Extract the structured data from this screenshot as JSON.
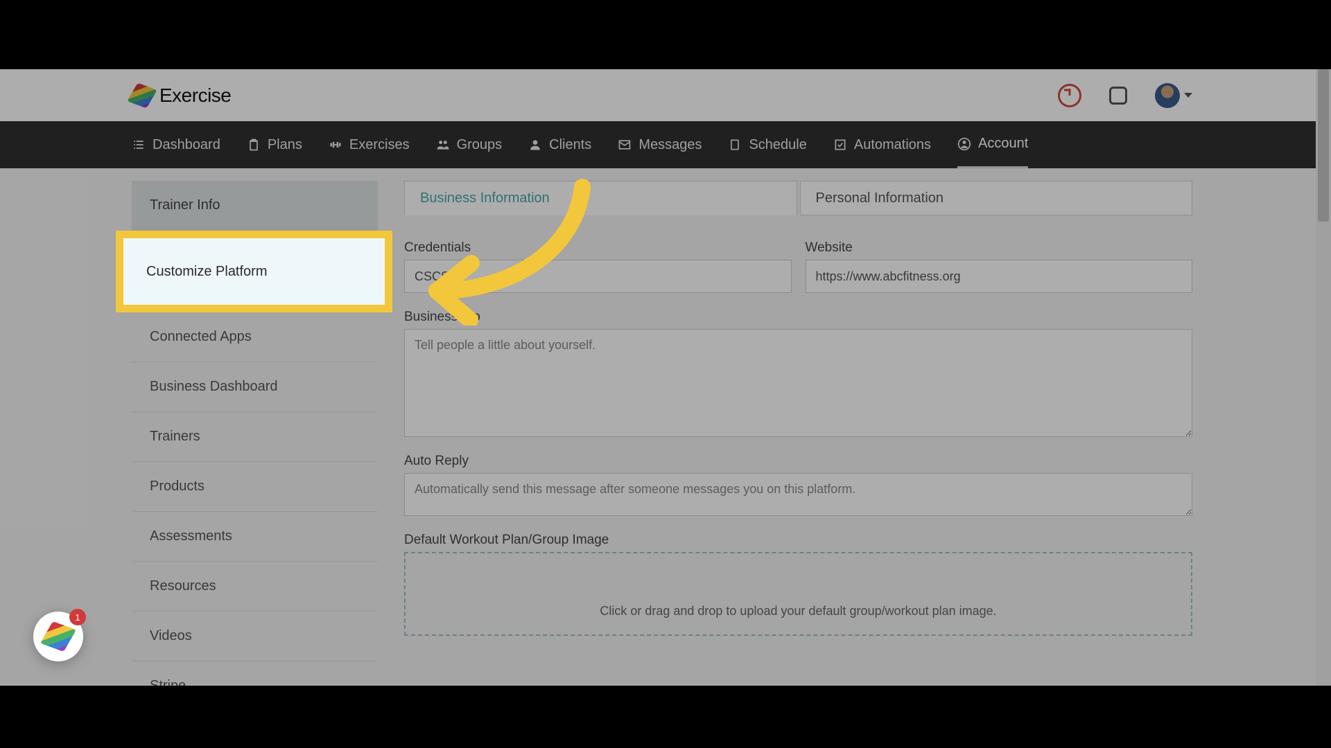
{
  "brand": {
    "name": "Exercise"
  },
  "nav": [
    {
      "label": "Dashboard"
    },
    {
      "label": "Plans"
    },
    {
      "label": "Exercises"
    },
    {
      "label": "Groups"
    },
    {
      "label": "Clients"
    },
    {
      "label": "Messages"
    },
    {
      "label": "Schedule"
    },
    {
      "label": "Automations"
    },
    {
      "label": "Account"
    }
  ],
  "sidebar": {
    "items": [
      {
        "label": "Trainer Info"
      },
      {
        "label": "Customize Platform"
      },
      {
        "label": "Connected Apps"
      },
      {
        "label": "Business Dashboard"
      },
      {
        "label": "Trainers"
      },
      {
        "label": "Products"
      },
      {
        "label": "Assessments"
      },
      {
        "label": "Resources"
      },
      {
        "label": "Videos"
      },
      {
        "label": "Stripe"
      }
    ]
  },
  "tabs": {
    "business": "Business Information",
    "personal": "Personal Information"
  },
  "form": {
    "credentials": {
      "label": "Credentials",
      "value": "CSCS"
    },
    "website": {
      "label": "Website",
      "value": "https://www.abcfitness.org"
    },
    "bio": {
      "label": "Business Bio",
      "placeholder": "Tell people a little about yourself."
    },
    "auto_reply": {
      "label": "Auto Reply",
      "placeholder": "Automatically send this message after someone messages you on this platform."
    },
    "default_image": {
      "label": "Default Workout Plan/Group Image",
      "dropzone_line1": "Click or drag and drop to upload your default group/workout plan image."
    }
  },
  "widget": {
    "badge": "1"
  }
}
